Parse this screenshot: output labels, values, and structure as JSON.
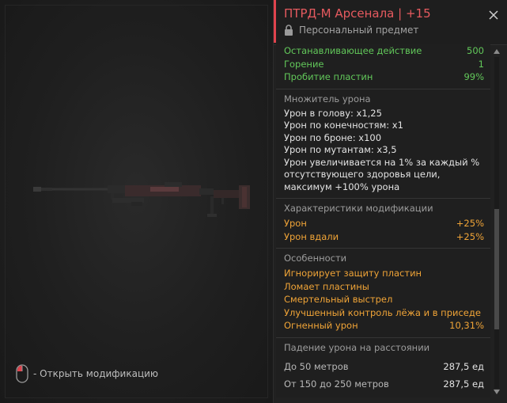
{
  "preview": {
    "hint_text": "- Открыть модификацию",
    "icons": [
      "weapon-image",
      "mouse-icon"
    ]
  },
  "header": {
    "title": "ПТРД-М Арсенала | +15",
    "subtitle": "Персональный предмет",
    "accent_color": "#e0434d",
    "icons": [
      "lock-icon",
      "close-icon"
    ]
  },
  "stats": [
    {
      "label": "Останавливающее действие",
      "value": "500"
    },
    {
      "label": "Горение",
      "value": "1"
    },
    {
      "label": "Пробитие пластин",
      "value": "99%"
    }
  ],
  "damage_multiplier": {
    "heading": "Множитель урона",
    "lines": [
      "Урон в голову: x1,25",
      "Урон по конечностям: x1",
      "Урон по броне: x100",
      "Урон по мутантам: x3,5",
      "Урон увеличивается на 1% за каждый %",
      "отсутствующего здоровья цели,",
      "максимум +100% урона"
    ]
  },
  "modification": {
    "heading": "Характеристики модификации",
    "rows": [
      {
        "label": "Урон",
        "value": "+25%"
      },
      {
        "label": "Урон вдали",
        "value": "+25%"
      }
    ]
  },
  "features": {
    "heading": "Особенности",
    "items": [
      "Игнорирует защиту пластин",
      "Ломает пластины",
      "Смертельный выстрел",
      "Улучшенный контроль лёжа и в приседе"
    ],
    "fire_damage": {
      "label": "Огненный урон",
      "value": "10,31%"
    }
  },
  "falloff": {
    "heading": "Падение урона на расстоянии",
    "rows": [
      {
        "label": "До 50 метров",
        "value": "287,5 ед"
      },
      {
        "label": "От 150 до 250 метров",
        "value": "287,5 ед"
      }
    ]
  },
  "colors": {
    "green": "#62c85a",
    "orange": "#f0a437",
    "title_red": "#e65a5f"
  }
}
